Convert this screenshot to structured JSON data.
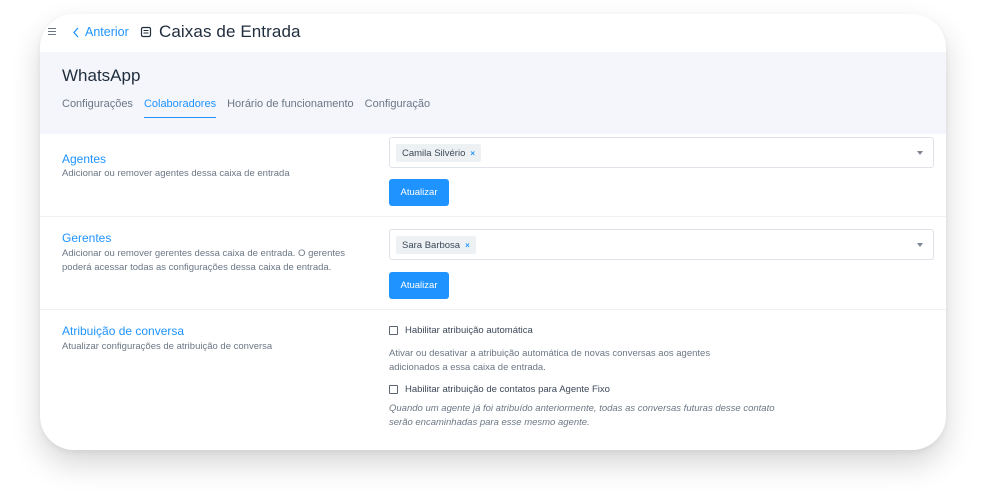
{
  "topbar": {
    "back_label": "Anterior",
    "title": "Caixas de Entrada"
  },
  "inbox": {
    "name": "WhatsApp"
  },
  "tabs": [
    {
      "label": "Configurações",
      "active": false
    },
    {
      "label": "Colaboradores",
      "active": true
    },
    {
      "label": "Horário de funcionamento",
      "active": false
    },
    {
      "label": "Configuração",
      "active": false
    }
  ],
  "agents": {
    "title": "Agentes",
    "description": "Adicionar ou remover agentes dessa caixa de entrada",
    "selected": "Camila Silvério",
    "remove": "×",
    "button": "Atualizar"
  },
  "managers": {
    "title": "Gerentes",
    "description": "Adicionar ou remover gerentes dessa caixa de entrada. O gerentes poderá acessar todas as configurações dessa caixa de entrada.",
    "selected": "Sara Barbosa",
    "remove": "×",
    "button": "Atualizar"
  },
  "assignment": {
    "title": "Atribuição de conversa",
    "description": "Atualizar configurações de atribuição de conversa",
    "auto_assign_label": "Habilitar atribuição automática",
    "auto_assign_checked": false,
    "auto_assign_help": "Ativar ou desativar a atribuição automática de novas conversas aos agentes adicionados a essa caixa de entrada.",
    "fixed_agent_label": "Habilitar atribuição de contatos para Agente Fixo",
    "fixed_agent_checked": false,
    "fixed_agent_help": "Quando um agente já foi atribuído anteriormente, todas as conversas futuras desse contato serão encaminhadas para esse mesmo agente."
  },
  "colors": {
    "accent": "#1f93ff",
    "header_bg": "#f4f6fb",
    "text_dark": "#1f2d3d",
    "text_muted": "#6b7785"
  }
}
